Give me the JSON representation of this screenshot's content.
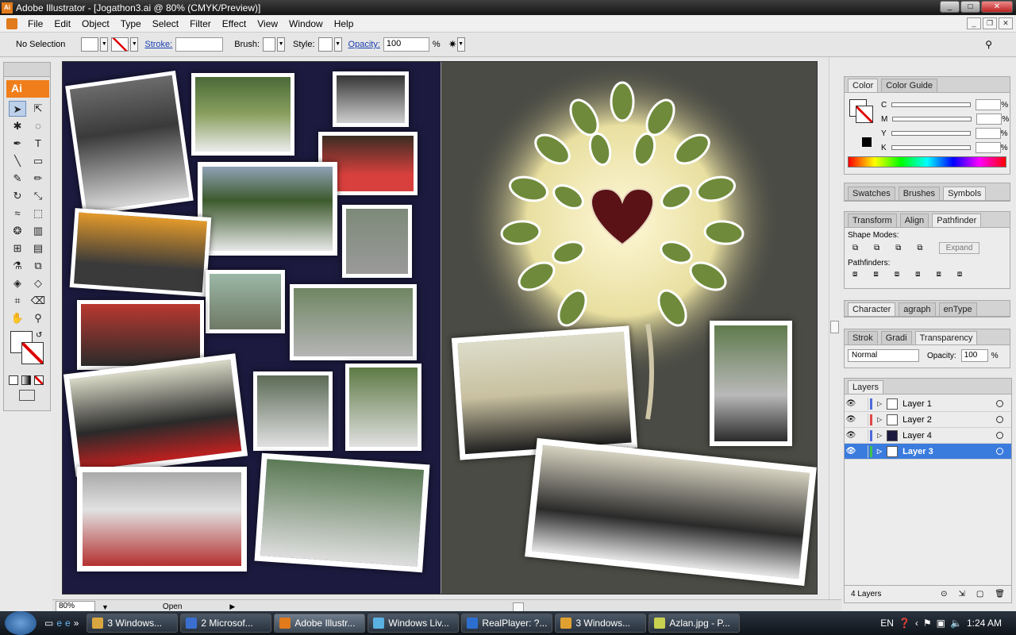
{
  "window": {
    "title": "Adobe Illustrator - [Jogathon3.ai @ 80% (CMYK/Preview)]",
    "app_icon": "Ai"
  },
  "menu": [
    "File",
    "Edit",
    "Object",
    "Type",
    "Select",
    "Filter",
    "Effect",
    "View",
    "Window",
    "Help"
  ],
  "control_bar": {
    "selection": "No Selection",
    "stroke_label": "Stroke:",
    "brush_label": "Brush:",
    "style_label": "Style:",
    "opacity_label": "Opacity:",
    "opacity_value": "100",
    "percent": "%"
  },
  "tools": {
    "logo": "Ai"
  },
  "statusbar": {
    "zoom": "80%",
    "status": "Open"
  },
  "color_panel": {
    "tabs": [
      "Color",
      "Color Guide"
    ],
    "channels": [
      "C",
      "M",
      "Y",
      "K"
    ],
    "unit": "%"
  },
  "swatch_panel": {
    "tabs": [
      "Swatches",
      "Brushes",
      "Symbols"
    ]
  },
  "pathfinder_panel": {
    "tabs": [
      "Transform",
      "Align",
      "Pathfinder"
    ],
    "shape_modes": "Shape Modes:",
    "expand": "Expand",
    "pathfinders": "Pathfinders:"
  },
  "character_panel": {
    "tabs": [
      "Character",
      "agraph",
      "enType"
    ]
  },
  "transparency_panel": {
    "tabs": [
      "Strok",
      "Gradi",
      "Transparency"
    ],
    "blend_mode": "Normal",
    "opacity_label": "Opacity:",
    "opacity_value": "100",
    "unit": "%"
  },
  "layers_panel": {
    "tab": "Layers",
    "layers": [
      {
        "name": "Layer 1",
        "color": "#4f6bd8"
      },
      {
        "name": "Layer 2",
        "color": "#e04848"
      },
      {
        "name": "Layer 4",
        "color": "#4f6bd8"
      },
      {
        "name": "Layer 3",
        "color": "#3fc24a"
      }
    ],
    "count": "4 Layers"
  },
  "taskbar": {
    "tasks": [
      "3 Windows...",
      "2 Microsof...",
      "Adobe Illustr...",
      "Windows Liv...",
      "RealPlayer: ?...",
      "3 Windows...",
      "Azlan.jpg - P..."
    ],
    "lang": "EN",
    "clock": "1:24 AM"
  }
}
